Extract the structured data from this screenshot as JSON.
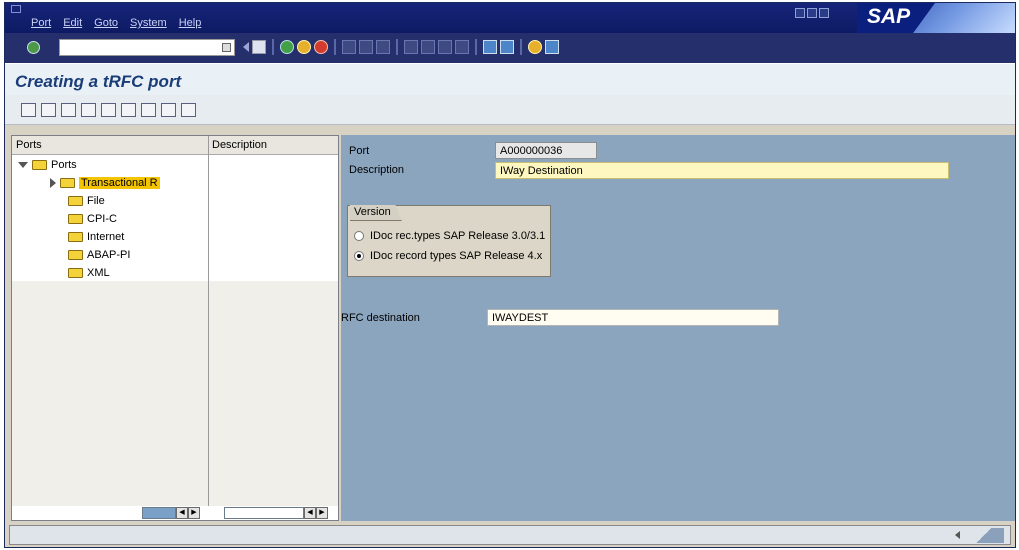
{
  "menu": {
    "items": [
      "Port",
      "Edit",
      "Goto",
      "System",
      "Help"
    ],
    "logo": "SAP"
  },
  "title": "Creating a tRFC port",
  "tree": {
    "col_ports": "Ports",
    "col_description": "Description",
    "root": "Ports",
    "items": [
      "Transactional R",
      "File",
      "CPI-C",
      "Internet",
      "ABAP-PI",
      "XML"
    ]
  },
  "form": {
    "port_label": "Port",
    "port_value": "A000000036",
    "description_label": "Description",
    "description_value": "IWay Destination",
    "version_title": "Version",
    "version_options": [
      "IDoc rec.types SAP Release 3.0/3.1",
      "IDoc record types SAP Release 4.x"
    ],
    "selected_version_index": 1,
    "rfc_label": "RFC destination",
    "rfc_value": "IWAYDEST"
  },
  "icons": {
    "system_toolbar": [
      "enter-icon",
      "save-icon",
      "back-icon",
      "exit-icon",
      "cancel-icon",
      "print-icon",
      "find-icon",
      "find-next-icon",
      "first-page-icon",
      "previous-page-icon",
      "next-page-icon",
      "last-page-icon",
      "create-session-icon",
      "shortcut-icon",
      "help-icon",
      "layout-icon"
    ],
    "app_toolbar": [
      "create-icon",
      "change-icon",
      "copy-icon",
      "delete-icon",
      "find-icon",
      "expand-icon",
      "refresh-icon",
      "save-icon",
      "print-icon"
    ]
  },
  "colors": {
    "menu_bg": "#17257a",
    "title_text": "#1a3c78",
    "right_pane_bg": "#8ca5bf",
    "selection": "#f5c400",
    "description_field": "#fff7c0"
  }
}
